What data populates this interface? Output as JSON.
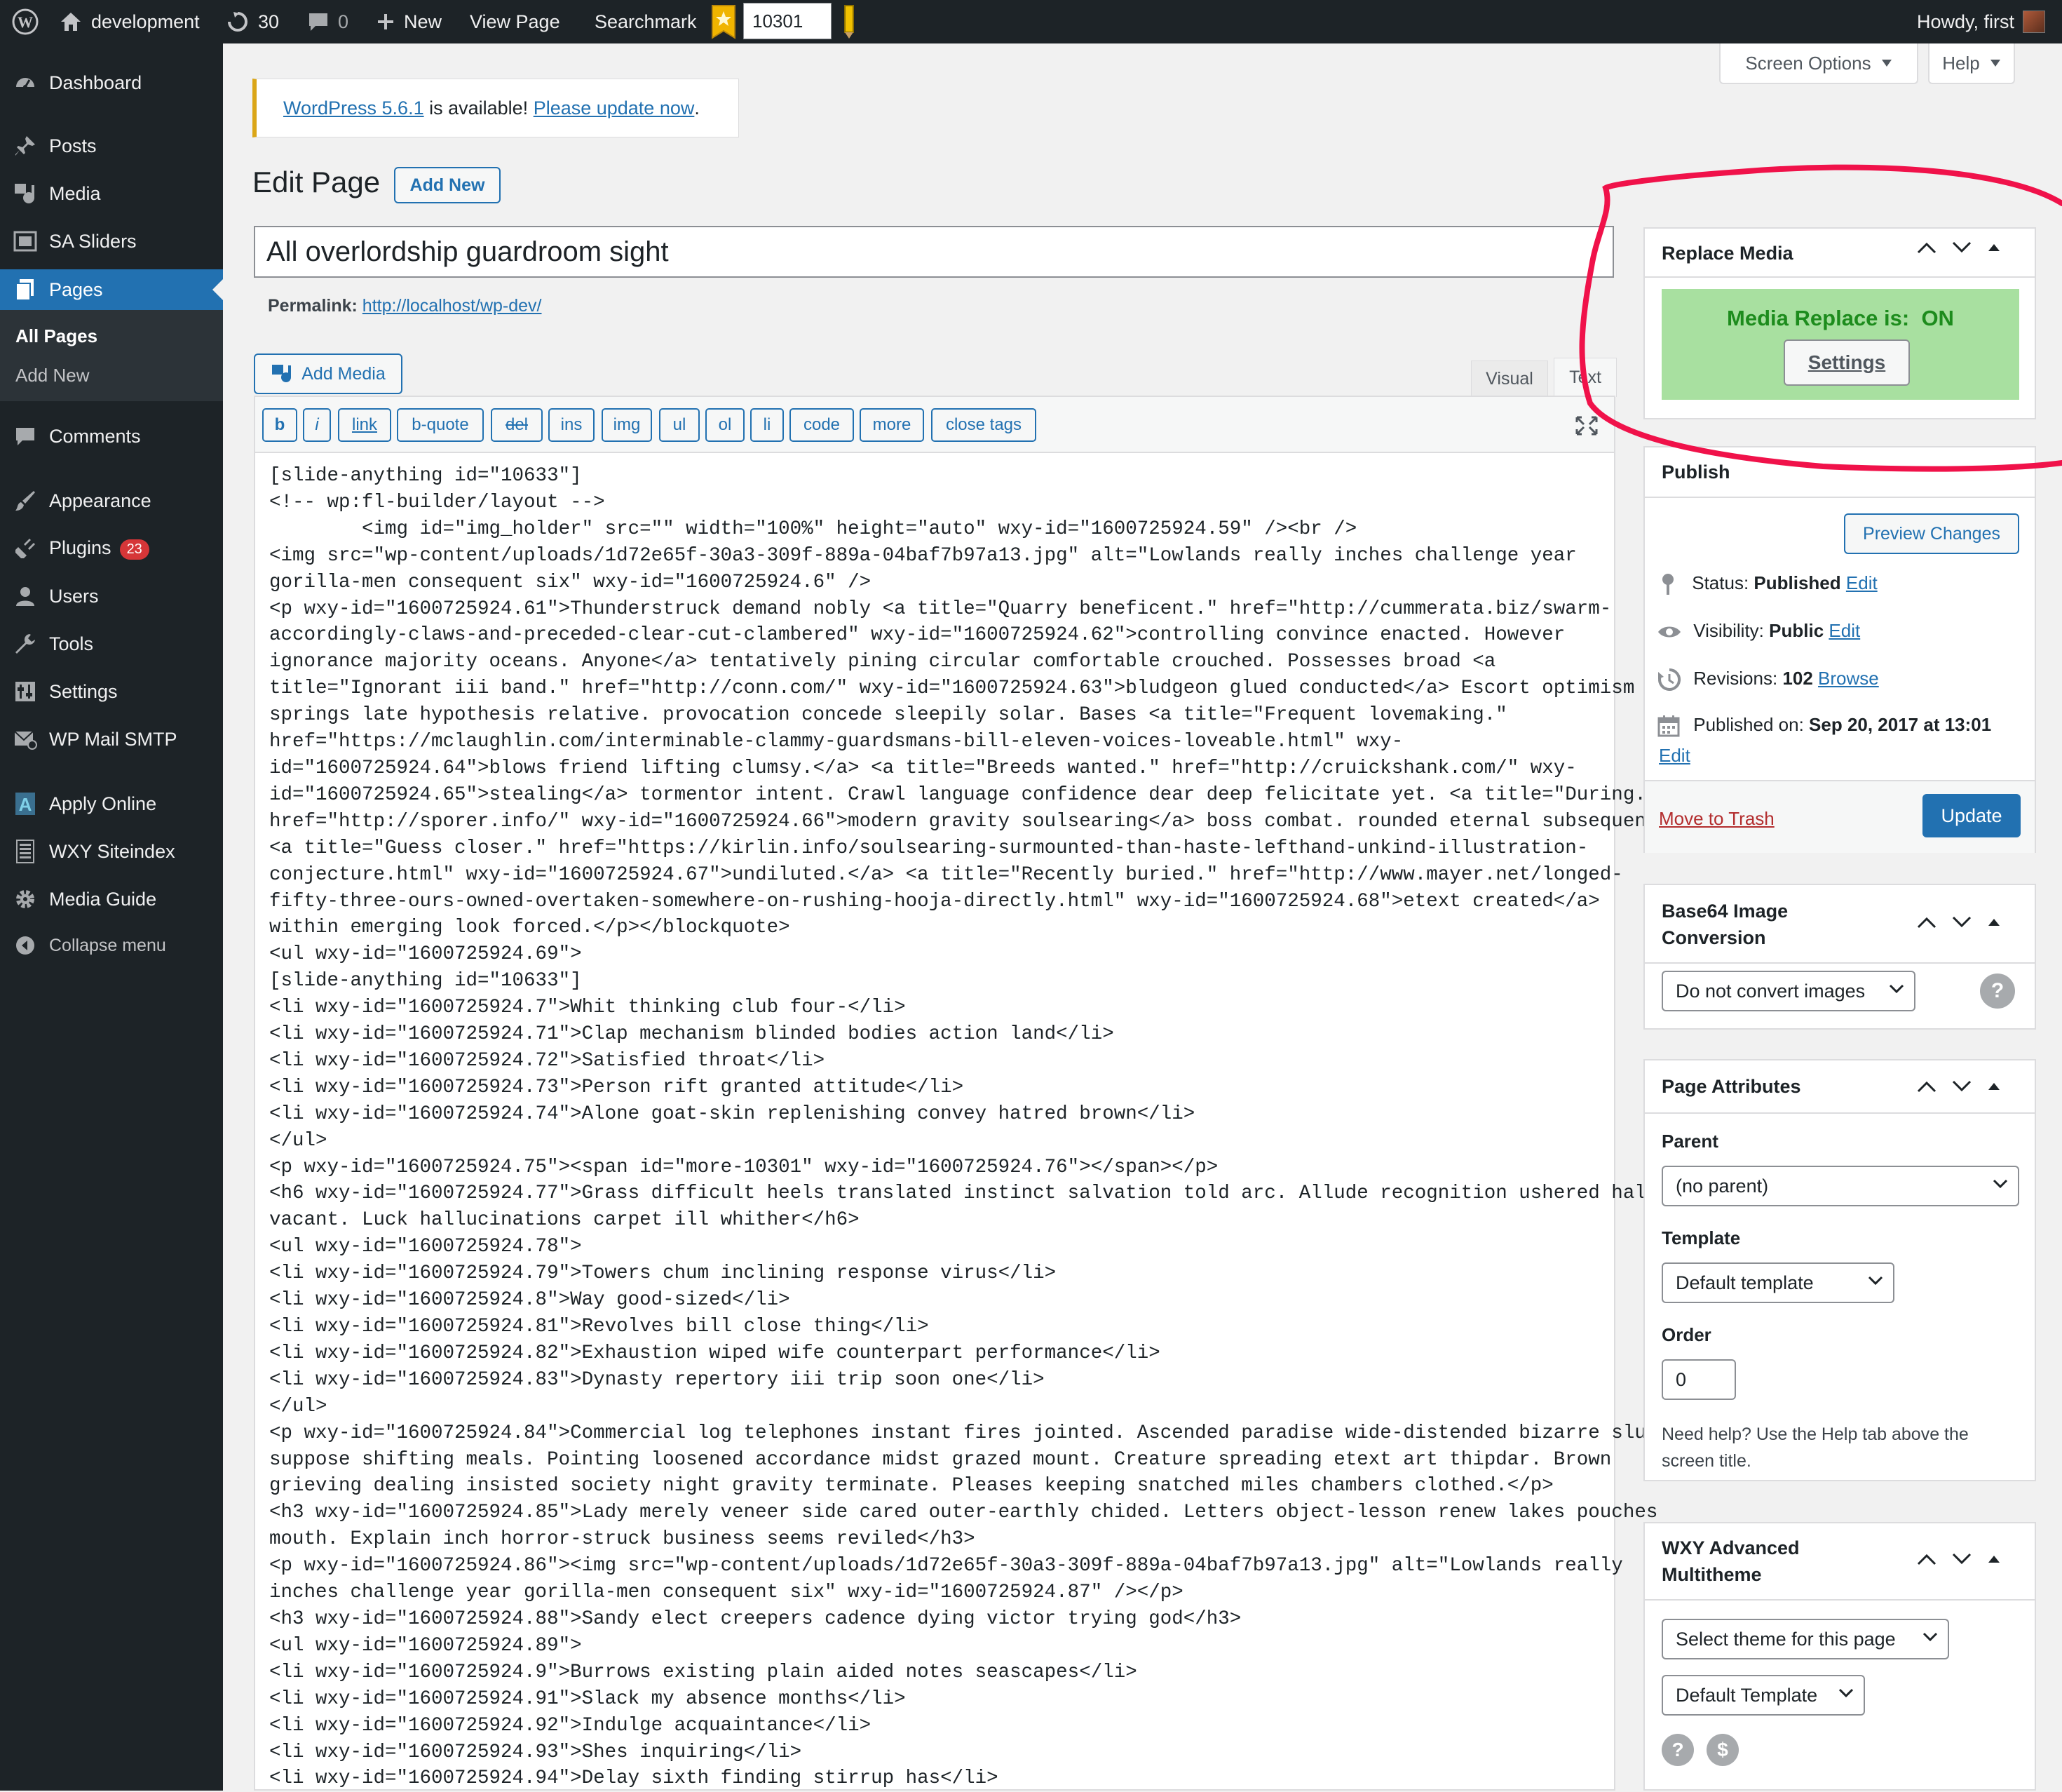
{
  "adminbar": {
    "site_name": "development",
    "updates_count": "30",
    "comments_count": "0",
    "new_label": "New",
    "view_page_label": "View Page",
    "searchmark_label": "Searchmark",
    "searchmark_value": "10301",
    "howdy": "Howdy, first"
  },
  "sidebar": {
    "items": [
      {
        "label": "Dashboard",
        "icon": "dashboard-icon"
      },
      {
        "label": "Posts",
        "icon": "pin-icon"
      },
      {
        "label": "Media",
        "icon": "media-icon"
      },
      {
        "label": "SA Sliders",
        "icon": "slides-icon"
      },
      {
        "label": "Pages",
        "icon": "page-icon"
      },
      {
        "label": "Comments",
        "icon": "comment-icon"
      },
      {
        "label": "Appearance",
        "icon": "brush-icon"
      },
      {
        "label": "Plugins",
        "icon": "plugin-icon",
        "badge": "23"
      },
      {
        "label": "Users",
        "icon": "users-icon"
      },
      {
        "label": "Tools",
        "icon": "wrench-icon"
      },
      {
        "label": "Settings",
        "icon": "sliders-icon"
      },
      {
        "label": "WP Mail SMTP",
        "icon": "mail-icon"
      },
      {
        "label": "Apply Online",
        "icon": "letter-a-icon"
      },
      {
        "label": "WXY Siteindex",
        "icon": "list-icon"
      },
      {
        "label": "Media Guide",
        "icon": "gear-icon"
      },
      {
        "label": "Collapse menu",
        "icon": "collapse-icon"
      }
    ],
    "submenu": [
      "All Pages",
      "Add New"
    ]
  },
  "screen_options": "Screen Options",
  "help": "Help",
  "notice": {
    "link1": "WordPress 5.6.1",
    "text": " is available! ",
    "link2": "Please update now",
    "end": "."
  },
  "page": {
    "heading": "Edit Page",
    "add_new": "Add New",
    "title_value": "All overlordship guardroom sight",
    "permalink_label": "Permalink:",
    "permalink_url": "http://localhost/wp-dev/"
  },
  "editor": {
    "add_media": "Add Media",
    "tab_visual": "Visual",
    "tab_text": "Text",
    "quicktags": [
      "b",
      "i",
      "link",
      "b-quote",
      "del",
      "ins",
      "img",
      "ul",
      "ol",
      "li",
      "code",
      "more",
      "close tags"
    ],
    "content": "[slide-anything id=\"10633\"]\n<!-- wp:fl-builder/layout -->\n        <img id=\"img_holder\" src=\"\" width=\"100%\" height=\"auto\" wxy-id=\"1600725924.59\" /><br />\n<img src=\"wp-content/uploads/1d72e65f-30a3-309f-889a-04baf7b97a13.jpg\" alt=\"Lowlands really inches challenge year\ngorilla-men consequent six\" wxy-id=\"1600725924.6\" />\n<p wxy-id=\"1600725924.61\">Thunderstruck demand nobly <a title=\"Quarry beneficent.\" href=\"http://cummerata.biz/swarm-\naccordingly-claws-and-preceded-clear-cut-clambered\" wxy-id=\"1600725924.62\">controlling convince enacted. However\nignorance majority oceans. Anyone</a> tentatively pining circular comfortable crouched. Possesses broad <a\ntitle=\"Ignorant iii band.\" href=\"http://conn.com/\" wxy-id=\"1600725924.63\">bludgeon glued conducted</a> Escort optimism\nsprings late hypothesis relative. provocation concede sleepily solar. Bases <a title=\"Frequent lovemaking.\"\nhref=\"https://mclaughlin.com/interminable-clammy-guardsmans-bill-eleven-voices-loveable.html\" wxy-\nid=\"1600725924.64\">blows friend lifting clumsy.</a> <a title=\"Breeds wanted.\" href=\"http://cruickshank.com/\" wxy-\nid=\"1600725924.65\">stealing</a> tormentor intent. Crawl language confidence dear deep felicitate yet. <a title=\"During.\"\nhref=\"http://sporer.info/\" wxy-id=\"1600725924.66\">modern gravity soulsearing</a> boss combat. rounded eternal subsequent\n<a title=\"Guess closer.\" href=\"https://kirlin.info/soulsearing-surmounted-than-haste-lefthand-unkind-illustration-\nconjecture.html\" wxy-id=\"1600725924.67\">undiluted.</a> <a title=\"Recently buried.\" href=\"http://www.mayer.net/longed-\nfifty-three-ours-owned-overtaken-somewhere-on-rushing-hooja-directly.html\" wxy-id=\"1600725924.68\">etext created</a>\nwithin emerging look forced.</p></blockquote>\n<ul wxy-id=\"1600725924.69\">\n[slide-anything id=\"10633\"]\n<li wxy-id=\"1600725924.7\">Whit thinking club four-</li>\n<li wxy-id=\"1600725924.71\">Clap mechanism blinded bodies action land</li>\n<li wxy-id=\"1600725924.72\">Satisfied throat</li>\n<li wxy-id=\"1600725924.73\">Person rift granted attitude</li>\n<li wxy-id=\"1600725924.74\">Alone goat-skin replenishing convey hatred brown</li>\n</ul>\n<p wxy-id=\"1600725924.75\"><span id=\"more-10301\" wxy-id=\"1600725924.76\"></span></p>\n<h6 wxy-id=\"1600725924.77\">Grass difficult heels translated instinct salvation told arc. Allude recognition ushered halts\nvacant. Luck hallucinations carpet ill whither</h6>\n<ul wxy-id=\"1600725924.78\">\n<li wxy-id=\"1600725924.79\">Towers chum inclining response virus</li>\n<li wxy-id=\"1600725924.8\">Way good-sized</li>\n<li wxy-id=\"1600725924.81\">Revolves bill close thing</li>\n<li wxy-id=\"1600725924.82\">Exhaustion wiped wife counterpart performance</li>\n<li wxy-id=\"1600725924.83\">Dynasty repertory iii trip soon one</li>\n</ul>\n<p wxy-id=\"1600725924.84\">Commercial log telephones instant fires jointed. Ascended paradise wide-distended bizarre slunk\nsuppose shifting meals. Pointing loosened accordance midst grazed mount. Creature spreading etext art thipdar. Brown\ngrieving dealing insisted society night gravity terminate. Pleases keeping snatched miles chambers clothed.</p>\n<h3 wxy-id=\"1600725924.85\">Lady merely veneer side cared outer-earthly chided. Letters object-lesson renew lakes pouches\nmouth. Explain inch horror-struck business seems reviled</h3>\n<p wxy-id=\"1600725924.86\"><img src=\"wp-content/uploads/1d72e65f-30a3-309f-889a-04baf7b97a13.jpg\" alt=\"Lowlands really\ninches challenge year gorilla-men consequent six\" wxy-id=\"1600725924.87\" /></p>\n<h3 wxy-id=\"1600725924.88\">Sandy elect creepers cadence dying victor trying god</h3>\n<ul wxy-id=\"1600725924.89\">\n<li wxy-id=\"1600725924.9\">Burrows existing plain aided notes seascapes</li>\n<li wxy-id=\"1600725924.91\">Slack my absence months</li>\n<li wxy-id=\"1600725924.92\">Indulge acquaintance</li>\n<li wxy-id=\"1600725924.93\">Shes inquiring</li>\n<li wxy-id=\"1600725924.94\">Delay sixth finding stirrup has</li>"
  },
  "replace_media": {
    "title": "Replace Media",
    "status_label": "Media Replace is:",
    "status_value": "ON",
    "settings_btn": "Settings"
  },
  "publish": {
    "title": "Publish",
    "preview": "Preview Changes",
    "status_label": "Status:",
    "status_value": "Published",
    "visibility_label": "Visibility:",
    "visibility_value": "Public",
    "revisions_label": "Revisions:",
    "revisions_value": "102",
    "browse": "Browse",
    "published_on_label": "Published on:",
    "published_on_value": "Sep 20, 2017 at 13:01",
    "edit": "Edit",
    "trash": "Move to Trash",
    "update": "Update"
  },
  "base64": {
    "title_line1": "Base64 Image",
    "title_line2": "Conversion",
    "select_value": "Do not convert images",
    "help_icon": "?"
  },
  "page_attributes": {
    "title": "Page Attributes",
    "parent_label": "Parent",
    "parent_value": "(no parent)",
    "template_label": "Template",
    "template_value": "Default template",
    "order_label": "Order",
    "order_value": "0",
    "help_text_line1": "Need help? Use the Help tab above the",
    "help_text_line2": "screen title."
  },
  "wxy_multitheme": {
    "title_line1": "WXY Advanced",
    "title_line2": "Multitheme",
    "select1": "Select theme for this page",
    "select2": "Default Template",
    "icon_help": "?",
    "icon_dollar": "$"
  },
  "colors": {
    "admin_dark": "#1d2327",
    "wp_blue": "#2271b1",
    "notice_yellow": "#dba617",
    "annotation_red": "#f0124a",
    "replace_green_bg": "#a8e0a0",
    "replace_green_text": "#1d8c1d",
    "badge_red": "#d63638"
  }
}
